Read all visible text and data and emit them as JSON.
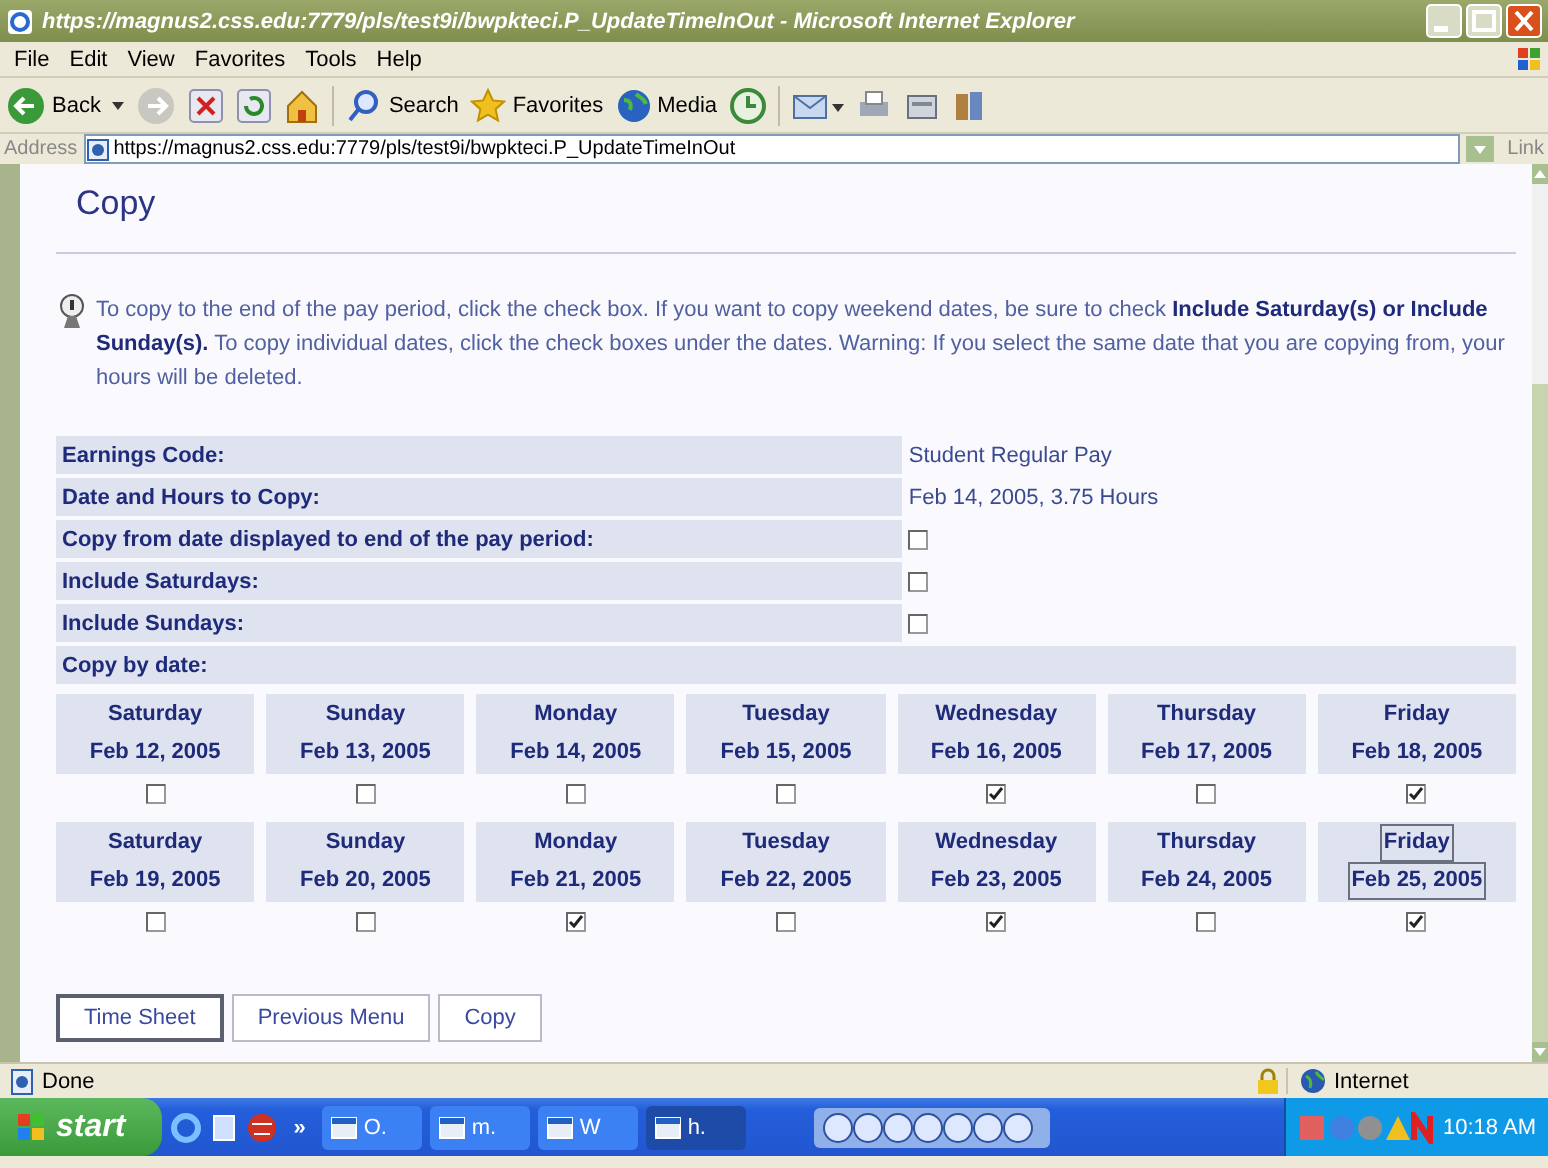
{
  "window": {
    "title": "https://magnus2.css.edu:7779/pls/test9i/bwpkteci.P_UpdateTimeInOut - Microsoft Internet Explorer"
  },
  "menu": [
    "File",
    "Edit",
    "View",
    "Favorites",
    "Tools",
    "Help"
  ],
  "toolbar": {
    "back": "Back",
    "search": "Search",
    "favorites": "Favorites",
    "media": "Media"
  },
  "address": {
    "label": "Address",
    "value": "https://magnus2.css.edu:7779/pls/test9i/bwpkteci.P_UpdateTimeInOut",
    "links": "Link"
  },
  "page": {
    "title": "Copy",
    "info": "To copy to the end of the pay period, click the check box. If you want to copy weekend dates, be sure to check **Include Saturday(s) or Include Sunday(s).** To copy individual dates, click the check boxes under the dates. Warning: If you select the same date that you are copying from, your hours will be deleted.",
    "fields": [
      {
        "label": "Earnings Code:",
        "kind": "text",
        "value": "Student Regular Pay"
      },
      {
        "label": "Date and Hours to Copy:",
        "kind": "text",
        "value": "Feb 14, 2005, 3.75 Hours"
      },
      {
        "label": "Copy from date displayed to end of the pay period:",
        "kind": "checkbox",
        "checked": false
      },
      {
        "label": "Include Saturdays:",
        "kind": "checkbox",
        "checked": false
      },
      {
        "label": "Include Sundays:",
        "kind": "checkbox",
        "checked": false
      }
    ],
    "copy_by_date": "Copy by date:",
    "weeks": [
      [
        {
          "day": "Saturday",
          "date": "Feb 12, 2005",
          "checked": false,
          "focused": false
        },
        {
          "day": "Sunday",
          "date": "Feb 13, 2005",
          "checked": false,
          "focused": false
        },
        {
          "day": "Monday",
          "date": "Feb 14, 2005",
          "checked": false,
          "focused": false
        },
        {
          "day": "Tuesday",
          "date": "Feb 15, 2005",
          "checked": false,
          "focused": false
        },
        {
          "day": "Wednesday",
          "date": "Feb 16, 2005",
          "checked": true,
          "focused": false
        },
        {
          "day": "Thursday",
          "date": "Feb 17, 2005",
          "checked": false,
          "focused": false
        },
        {
          "day": "Friday",
          "date": "Feb 18, 2005",
          "checked": true,
          "focused": false
        }
      ],
      [
        {
          "day": "Saturday",
          "date": "Feb 19, 2005",
          "checked": false,
          "focused": false
        },
        {
          "day": "Sunday",
          "date": "Feb 20, 2005",
          "checked": false,
          "focused": false
        },
        {
          "day": "Monday",
          "date": "Feb 21, 2005",
          "checked": true,
          "focused": false
        },
        {
          "day": "Tuesday",
          "date": "Feb 22, 2005",
          "checked": false,
          "focused": false
        },
        {
          "day": "Wednesday",
          "date": "Feb 23, 2005",
          "checked": true,
          "focused": false
        },
        {
          "day": "Thursday",
          "date": "Feb 24, 2005",
          "checked": false,
          "focused": false
        },
        {
          "day": "Friday",
          "date": "Feb 25, 2005",
          "checked": true,
          "focused": true
        }
      ]
    ],
    "buttons": [
      {
        "label": "Time Sheet",
        "default": true
      },
      {
        "label": "Previous Menu",
        "default": false
      },
      {
        "label": "Copy",
        "default": false
      }
    ]
  },
  "status": {
    "text": "Done",
    "zone": "Internet"
  },
  "taskbar": {
    "start": "start",
    "more": "»",
    "tasks": [
      {
        "label": "O.",
        "selected": false
      },
      {
        "label": "m.",
        "selected": false
      },
      {
        "label": "W",
        "selected": false
      },
      {
        "label": "h.",
        "selected": true
      }
    ],
    "clock": "10:18 AM"
  }
}
